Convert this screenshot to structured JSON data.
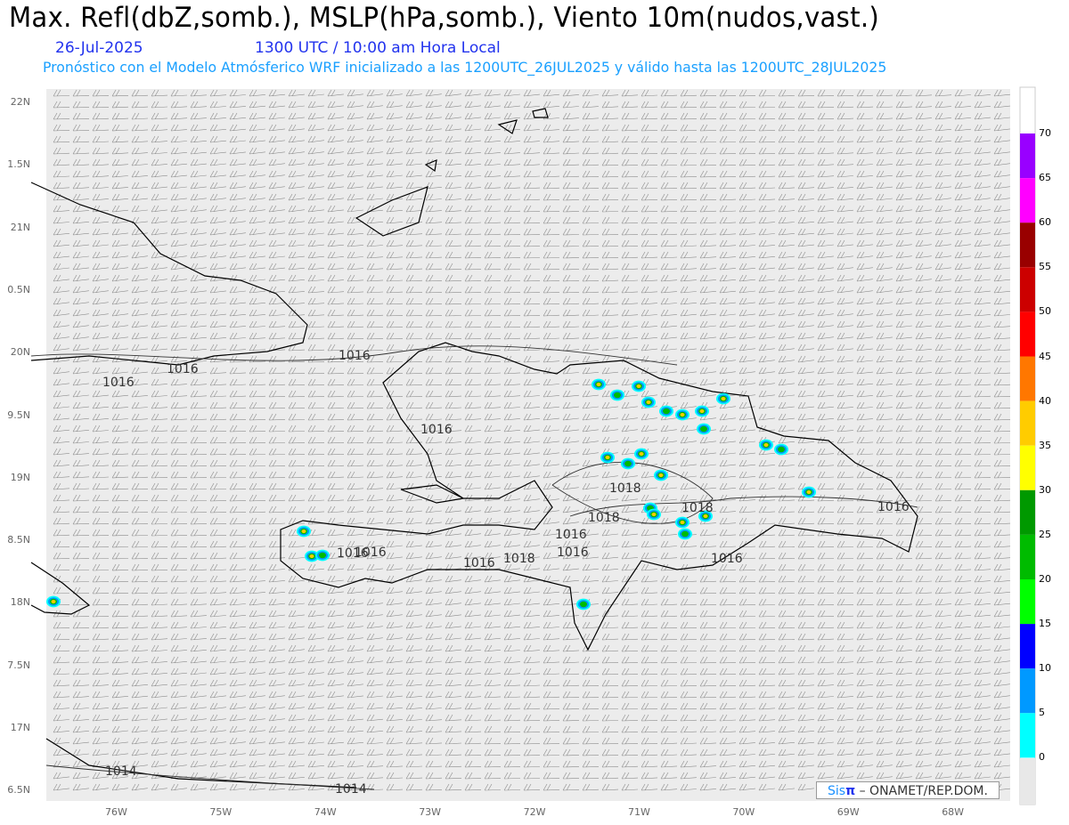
{
  "header": {
    "title": "Max. Refl(dbZ,somb.), MSLP(hPa,somb.), Viento 10m(nudos,vast.)",
    "date": "26-Jul-2025",
    "time": "1300 UTC / 10:00 am Hora Local",
    "forecast_info": "Pronóstico con el Modelo Atmósferico WRF inicializado a las 1200UTC_26JUL2025 y válido hasta las  1200UTC_28JUL2025"
  },
  "axes": {
    "lat_labels": [
      "22N",
      "1.5N",
      "21N",
      "0.5N",
      "20N",
      "9.5N",
      "19N",
      "8.5N",
      "18N",
      "7.5N",
      "17N",
      "6.5N"
    ],
    "lon_labels": [
      "76W",
      "75W",
      "74W",
      "73W",
      "72W",
      "71W",
      "70W",
      "69W",
      "68W"
    ]
  },
  "isobar_labels": [
    "1016",
    "1016",
    "1016",
    "1016",
    "1016",
    "1018",
    "1018",
    "1018",
    "1016",
    "1016",
    "1016",
    "1018",
    "1016",
    "1016",
    "1016",
    "1014",
    "1014"
  ],
  "colorbar": {
    "labels": [
      "70",
      "65",
      "60",
      "55",
      "50",
      "45",
      "40",
      "35",
      "30",
      "25",
      "20",
      "15",
      "10",
      "5",
      "0"
    ],
    "colors": [
      "#9900ff",
      "#ff00ff",
      "#990000",
      "#cc0000",
      "#ff0000",
      "#ff7700",
      "#ffcc00",
      "#ffff00",
      "#009900",
      "#00bb00",
      "#00ff00",
      "#0000ff",
      "#0099ff",
      "#00ffff"
    ]
  },
  "credit": {
    "sis": "Sis",
    "pi": "π",
    "org": "– ONAMET/REP.DOM."
  }
}
